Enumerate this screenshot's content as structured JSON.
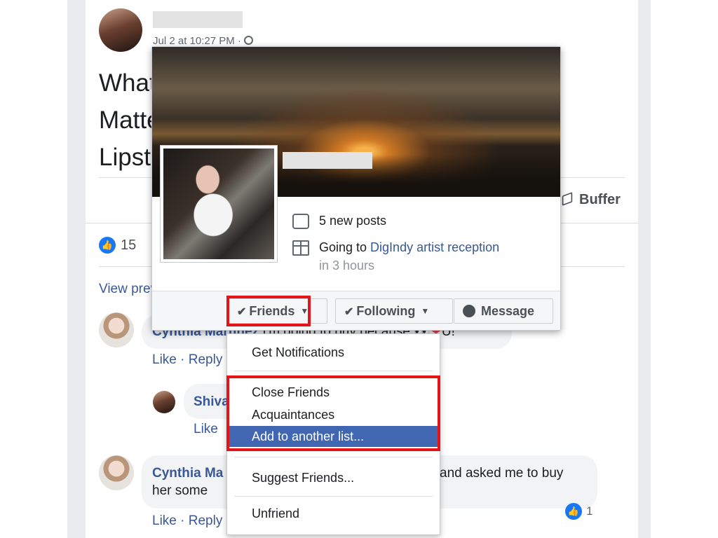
{
  "post": {
    "date": "Jul 2 at 10:27 PM ·",
    "text_lines": [
      "What",
      "Matte",
      "Lipst"
    ],
    "buffer_label": "Buffer",
    "like_count": "15",
    "view_previous": "View previous"
  },
  "comments": [
    {
      "name": "Cynthia Martinez",
      "text": "I'm going to buy because",
      "tail": "U!",
      "actions": [
        "Like",
        "Reply"
      ]
    },
    {
      "name": "Shiva",
      "actions": [
        "Like"
      ]
    },
    {
      "name": "Cynthia Ma",
      "text_tail": "and asked me to buy",
      "line2": "her some",
      "actions": [
        "Like",
        "Reply"
      ],
      "reaction_count": "1"
    }
  ],
  "hovercard": {
    "new_posts": "5 new posts",
    "event_prefix": "Going to ",
    "event_link": "DigIndy artist reception",
    "event_time": "in 3 hours",
    "buttons": {
      "friends": "Friends",
      "following": "Following",
      "message": "Message"
    }
  },
  "menu": {
    "items": [
      {
        "label": "Get Notifications"
      },
      {
        "label": "Close Friends"
      },
      {
        "label": "Acquaintances"
      },
      {
        "label": "Add to another list..."
      },
      {
        "label": "Suggest Friends..."
      },
      {
        "label": "Unfriend"
      }
    ]
  },
  "colors": {
    "link": "#385898",
    "highlight_red": "#e3141a",
    "menu_active": "#4267b2"
  }
}
